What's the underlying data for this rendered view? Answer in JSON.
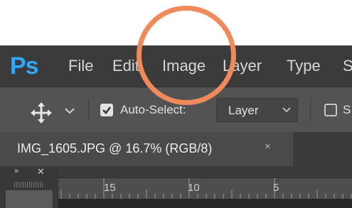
{
  "app": {
    "logo_text": "Ps"
  },
  "menu": {
    "items": [
      "File",
      "Edit",
      "Image",
      "Layer",
      "Type",
      "S"
    ]
  },
  "options_bar": {
    "auto_select_label": "Auto-Select:",
    "auto_select_checked": true,
    "auto_select_target": "Layer",
    "truncated_label": "S"
  },
  "document": {
    "tab_title": "IMG_1605.JPG @ 16.7% (RGB/8)",
    "close_symbol": "×"
  },
  "panel": {
    "collapse_symbol": "»",
    "close_symbol": "✕"
  },
  "ruler": {
    "labels": [
      "15",
      "10",
      "5"
    ]
  },
  "colors": {
    "accent_logo": "#31a8ff",
    "highlight": "#f08a5a",
    "menubar": "#3b3b3b",
    "optionsbar": "#535353"
  },
  "annotation": {
    "highlighted_item": "Image"
  }
}
